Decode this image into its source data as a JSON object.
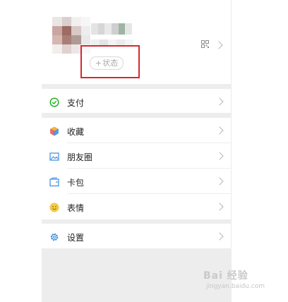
{
  "profile": {
    "status_button_label": "状态",
    "status_button_prefix": "+"
  },
  "menu": {
    "pay": {
      "label": "支付",
      "icon": "wallet-check-icon"
    },
    "favorites": {
      "label": "收藏",
      "icon": "cube-icon"
    },
    "moments": {
      "label": "朋友圈",
      "icon": "photo-icon"
    },
    "cards": {
      "label": "卡包",
      "icon": "card-holder-icon"
    },
    "stickers": {
      "label": "表情",
      "icon": "smiley-icon"
    },
    "settings": {
      "label": "设置",
      "icon": "gear-icon"
    }
  },
  "watermark": {
    "brand": "Bai 经验",
    "url": "jingyan.baidu.com"
  },
  "colors": {
    "highlight": "#d5292f",
    "pay_green": "#1aad19",
    "divider": "#ededed"
  }
}
